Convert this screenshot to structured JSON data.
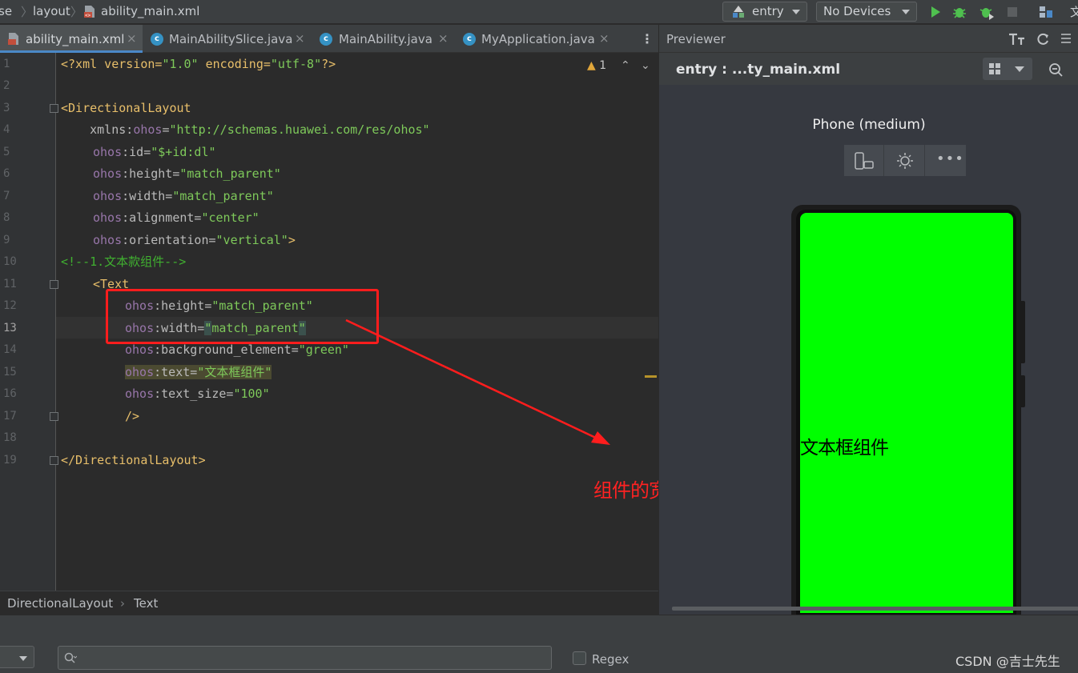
{
  "navbar": {
    "crumbs": [
      "se",
      "layout",
      "ability_main.xml"
    ],
    "run_config": "entry",
    "device": "No Devices",
    "far_right_glyph": "文"
  },
  "tabs": [
    {
      "label": "ability_main.xml",
      "active": true,
      "icon": "xml-file-icon"
    },
    {
      "label": "MainAbilitySlice.java",
      "active": false,
      "icon": "java-class-icon"
    },
    {
      "label": "MainAbility.java",
      "active": false,
      "icon": "java-class-icon"
    },
    {
      "label": "MyApplication.java",
      "active": false,
      "icon": "java-class-icon"
    }
  ],
  "editor": {
    "warning_count": "1",
    "line_numbers": [
      "1",
      "2",
      "3",
      "4",
      "5",
      "6",
      "7",
      "8",
      "9",
      "10",
      "11",
      "12",
      "13",
      "14",
      "15",
      "16",
      "17",
      "18",
      "19"
    ],
    "lines": {
      "l1_a": "<?xml version=",
      "l1_b": "\"1.0\"",
      "l1_c": " encoding=",
      "l1_d": "\"utf-8\"",
      "l1_e": "?>",
      "l3": "<DirectionalLayout",
      "l4_ns": "    xmlns:",
      "l4_attr": "ohos",
      "l4_eq": "=",
      "l4_val": "\"http://schemas.huawei.com/res/ohos\"",
      "ohos": "ohos",
      "l5_attr": ":id=",
      "l5_val": "\"$+id:dl\"",
      "l6_attr": ":height=",
      "l6_val": "\"match_parent\"",
      "l7_attr": ":width=",
      "l7_val": "\"match_parent\"",
      "l8_attr": ":alignment=",
      "l8_val": "\"center\"",
      "l9_attr": ":orientation=",
      "l9_val": "\"vertical\"",
      "l9_end": ">",
      "l10": "<!--1.文本款组件-->",
      "l11": "<Text",
      "l12_attr": ":height=",
      "l12_val": "\"match_parent\"",
      "l13_attr": ":width=",
      "l13_q1": "\"",
      "l13_val": "match_parent",
      "l13_q2": "\"",
      "l14_attr": ":background_element=",
      "l14_val": "\"green\"",
      "l15_attr": ":text=",
      "l15_val": "\"文本框组件\"",
      "l16_attr": ":text_size=",
      "l16_val": "\"100\"",
      "l17": "/>",
      "l19": "</DirectionalLayout>"
    }
  },
  "annotation": {
    "text": "组件的宽度和长度都占满整个屏幕",
    "color": "#ff2222"
  },
  "status_breadcrumb": [
    "DirectionalLayout",
    "Text"
  ],
  "previewer": {
    "title": "Previewer",
    "file": "entry : ...ty_main.xml",
    "device_name": "Phone (medium)",
    "screen_text": "文本框组件",
    "screen_color": "#00ff00"
  },
  "findbar": {
    "search_value": "",
    "regex_label": "Regex"
  },
  "watermark": "CSDN @吉士先生"
}
